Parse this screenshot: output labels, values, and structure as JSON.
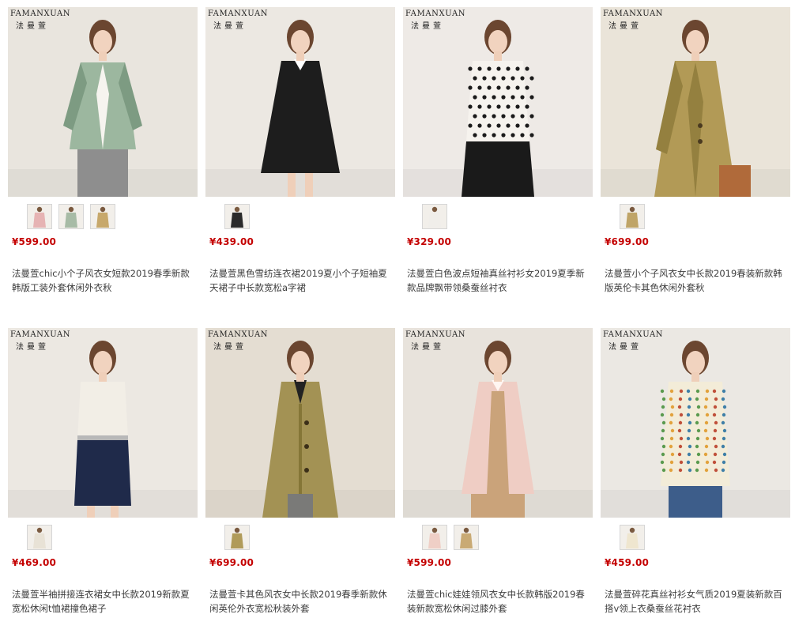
{
  "brand": {
    "en": "FAMANXUAN",
    "cn": "法曼萱"
  },
  "products": [
    {
      "price": "¥599.00",
      "title": "法曼萱chic小个子风衣女短款2019春季新款韩版工装外套休闲外衣秋",
      "has_brand": true,
      "bg": "#e9e5de",
      "garment": "#9cb79f",
      "garment_dark": "#7d9b82",
      "lower": "#8e8e8e",
      "style": "jacket",
      "thumbs": [
        "#e6b3b3",
        "#a7bba6",
        "#c7a86b"
      ]
    },
    {
      "price": "¥439.00",
      "title": "法曼萱黑色雪纺连衣裙2019夏小个子短袖夏天裙子中长款宽松a字裙",
      "has_brand": true,
      "bg": "#ece8e2",
      "garment": "#1d1d1d",
      "garment_dark": "#0f0f0f",
      "lower": "#1d1d1d",
      "style": "dress",
      "thumbs": [
        "#2a2a2a"
      ]
    },
    {
      "price": "¥329.00",
      "title": "法曼萱白色波点短袖真丝衬衫女2019夏季新款品牌飘带领桑蚕丝衬衣",
      "has_brand": true,
      "bg": "#eeeae6",
      "garment": "#f6f3ee",
      "garment_dark": "#1b1b1b",
      "lower": "#1a1a1a",
      "style": "polka",
      "thumbs": [
        "#f0eeea"
      ]
    },
    {
      "price": "¥699.00",
      "title": "法曼萱小个子风衣女中长款2019春装新款韩版英伦卡其色休闲外套秋",
      "has_brand": true,
      "bg": "#eae4d9",
      "garment": "#b29a56",
      "garment_dark": "#94803f",
      "lower": "#b06a3a",
      "style": "coat",
      "thumbs": [
        "#bfa467"
      ]
    },
    {
      "price": "¥469.00",
      "title": "法曼萱半袖拼接连衣裙女中长款2019新款夏宽松休闲t恤裙撞色裙子",
      "has_brand": true,
      "bg": "#ece8e2",
      "garment": "#f2eee6",
      "garment_dark": "#1f2a4a",
      "lower": "#1f2a4a",
      "style": "colorblock",
      "thumbs": [
        "#e8e2d6"
      ]
    },
    {
      "price": "¥699.00",
      "title": "法曼萱卡其色风衣女中长款2019春季新款休闲英伦外衣宽松秋装外套",
      "has_brand": true,
      "bg": "#e4ddd2",
      "garment": "#a39254",
      "garment_dark": "#857637",
      "lower": "#7a7a78",
      "style": "longcoat",
      "thumbs": [
        "#b09b5a"
      ]
    },
    {
      "price": "¥599.00",
      "title": "法曼萱chic娃娃领风衣女中长款韩版2019春装新款宽松休闲过膝外套",
      "has_brand": true,
      "bg": "#e8e3dc",
      "garment": "#efcdc4",
      "garment_dark": "#d5aea4",
      "lower": "#caa37a",
      "style": "pinkcoat",
      "thumbs": [
        "#efcfc6",
        "#c9aa74"
      ]
    },
    {
      "price": "¥459.00",
      "title": "法曼萱碎花真丝衬衫女气质2019夏装新款百搭v领上衣桑蚕丝花衬衣",
      "has_brand": true,
      "bg": "#ebe8e3",
      "garment": "#f3ecd8",
      "garment_dark": "#5a9a4e",
      "lower": "#3d5d8a",
      "style": "floral",
      "thumbs": [
        "#efe6cf"
      ]
    }
  ]
}
